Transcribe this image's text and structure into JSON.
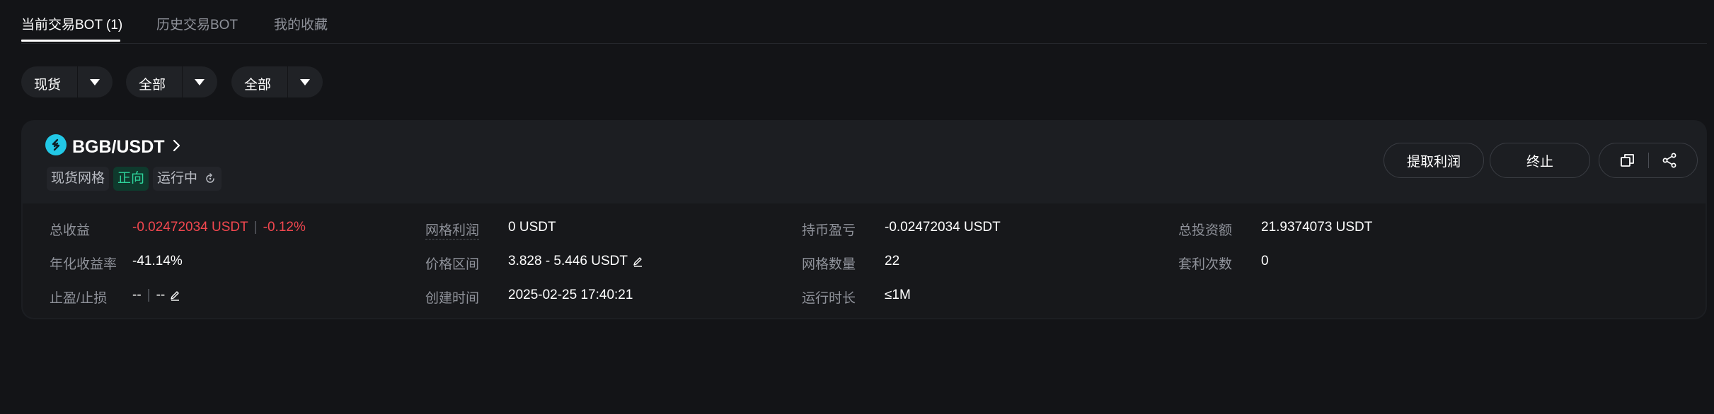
{
  "tabs": [
    {
      "label": "当前交易BOT (1)",
      "active": true
    },
    {
      "label": "历史交易BOT",
      "active": false
    },
    {
      "label": "我的收藏",
      "active": false
    }
  ],
  "filters": [
    {
      "selected": "现货"
    },
    {
      "selected": "全部"
    },
    {
      "selected": "全部"
    }
  ],
  "bot": {
    "pair": "BGB/USDT",
    "coin_icon": "bgb-coin-icon",
    "tags": {
      "type": "现货网格",
      "direction": "正向",
      "status": "运行中"
    },
    "actions": {
      "withdraw": "提取利润",
      "stop": "终止"
    },
    "stats": {
      "total_profit": {
        "label": "总收益",
        "value": "-0.02472034 USDT",
        "percent": "-0.12%"
      },
      "grid_profit": {
        "label": "网格利润",
        "value": "0 USDT"
      },
      "holding_pnl": {
        "label": "持币盈亏",
        "value": "-0.02472034 USDT"
      },
      "total_invest": {
        "label": "总投资额",
        "value": "21.9374073 USDT"
      },
      "annual_yield": {
        "label": "年化收益率",
        "value": "-41.14%"
      },
      "price_range": {
        "label": "价格区间",
        "value": "3.828 - 5.446 USDT"
      },
      "grid_count": {
        "label": "网格数量",
        "value": "22"
      },
      "arbitrage_count": {
        "label": "套利次数",
        "value": "0"
      },
      "tp_sl": {
        "label": "止盈/止损",
        "tp": "--",
        "sl": "--"
      },
      "created_time": {
        "label": "创建时间",
        "value": "2025-02-25 17:40:21"
      },
      "run_duration": {
        "label": "运行时长",
        "value": "≤1M"
      }
    }
  },
  "colors": {
    "background": "#131417",
    "card": "#1c1e22",
    "loss": "#f2474f",
    "positive_tag": "#2ed39b",
    "coin": "#22c8e6"
  }
}
